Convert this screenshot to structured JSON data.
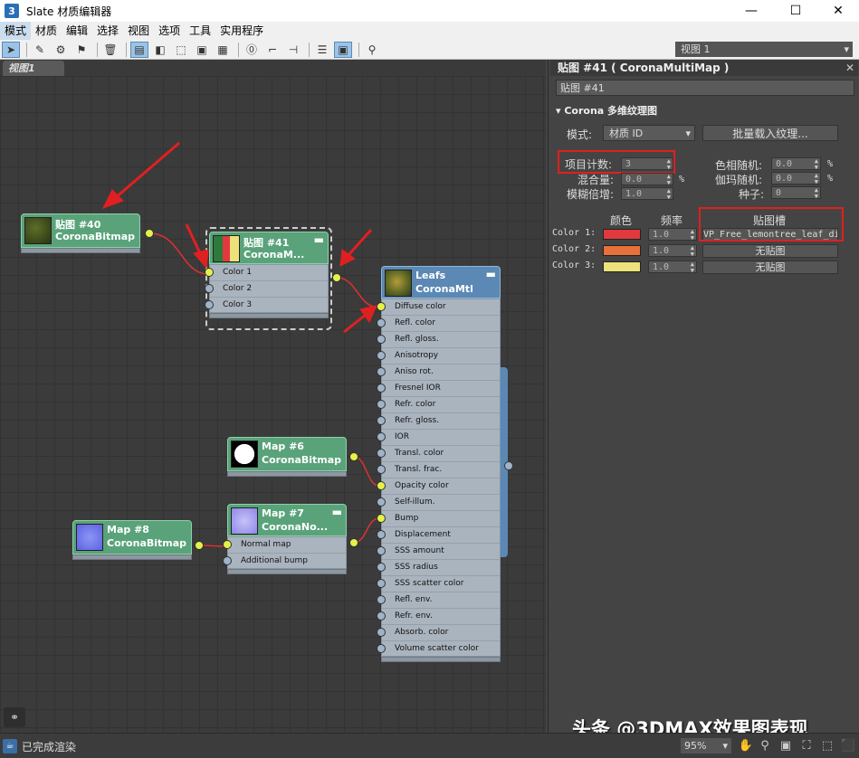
{
  "window": {
    "app_icon": "3",
    "title": "Slate 材质编辑器",
    "minimize": "—",
    "maximize": "☐",
    "close": "✕"
  },
  "menu": [
    "模式",
    "材质",
    "编辑",
    "选择",
    "视图",
    "选项",
    "工具",
    "实用程序"
  ],
  "toolbar": {
    "view_select": "视图 1"
  },
  "view_tab": "视图1",
  "nodes": {
    "n40": {
      "title": "贴图 #40",
      "sub": "CoronaBitmap"
    },
    "n41": {
      "title": "贴图 #41",
      "sub": "CoronaM...",
      "slots": [
        "Color 1",
        "Color 2",
        "Color 3"
      ]
    },
    "leafs": {
      "title": "Leafs",
      "sub": "CoronaMtl",
      "slots": [
        "Diffuse color",
        "Refl. color",
        "Refl. gloss.",
        "Anisotropy",
        "Aniso rot.",
        "Fresnel IOR",
        "Refr. color",
        "Refr. gloss.",
        "IOR",
        "Transl. color",
        "Transl. frac.",
        "Opacity color",
        "Self-illum.",
        "Bump",
        "Displacement",
        "SSS amount",
        "SSS radius",
        "SSS scatter color",
        "Refl. env.",
        "Refr. env.",
        "Absorb. color",
        "Volume scatter color"
      ]
    },
    "n6": {
      "title": "Map #6",
      "sub": "CoronaBitmap"
    },
    "n7": {
      "title": "Map #7",
      "sub": "CoronaNo...",
      "slots": [
        "Normal map",
        "Additional bump"
      ]
    },
    "n8": {
      "title": "Map #8",
      "sub": "CoronaBitmap"
    }
  },
  "panel": {
    "header": "贴图 #41  ( CoronaMultiMap )",
    "name_field": "贴图 #41",
    "rollout": "Corona 多维纹理图",
    "mode_label": "模式:",
    "mode_value": "材质 ID",
    "batch_button": "批量载入纹理...",
    "item_count_label": "项目计数:",
    "item_count_value": "3",
    "mix_label": "混合量:",
    "mix_value": "0.0",
    "blur_label": "模糊倍增:",
    "blur_value": "1.0",
    "hue_label": "色相随机:",
    "hue_value": "0.0",
    "gamma_label": "伽玛随机:",
    "gamma_value": "0.0",
    "seed_label": "种子:",
    "seed_value": "0",
    "percent": "%",
    "col_color": "颜色",
    "col_freq": "频率",
    "col_slot": "贴图槽",
    "rows": [
      {
        "label": "Color 1:",
        "color": "#e2393f",
        "freq": "1.0",
        "slot": "VP_Free_lemontree_leaf_di"
      },
      {
        "label": "Color 2:",
        "color": "#e8703a",
        "freq": "1.0",
        "slot": "无贴图"
      },
      {
        "label": "Color 3:",
        "color": "#ede27a",
        "freq": "1.0",
        "slot": "无贴图"
      }
    ]
  },
  "watermark": "头条 @3DMAX效果图表现",
  "status": {
    "text": "已完成渲染",
    "zoom": "95%"
  },
  "colors": {
    "node_green": "#5aa37a",
    "node_blue": "#5b88b4",
    "socket_on": "#e5f246",
    "annotation": "#e02020"
  }
}
